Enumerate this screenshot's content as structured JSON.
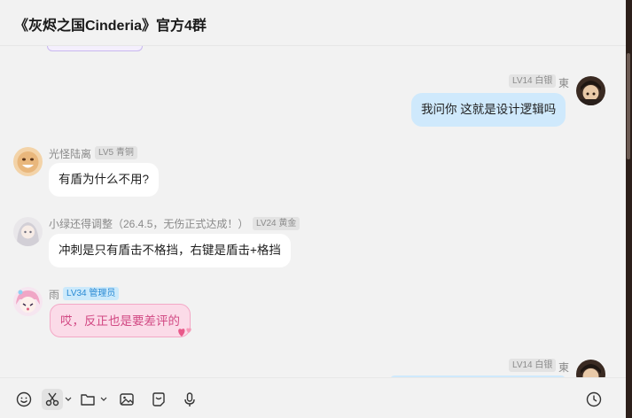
{
  "header": {
    "title": "《灰烬之国Cinderia》官方4群"
  },
  "messages": [
    {
      "side": "right",
      "name": "東",
      "badge": "LV14 白银",
      "text": "我问你 这就是设计逻辑吗"
    },
    {
      "side": "left",
      "name": "光怪陆离",
      "badge": "LV5 青铜",
      "text": "有盾为什么不用?"
    },
    {
      "side": "left",
      "name": "小绿还得调整（26.4.5，无伤正式达成！）",
      "badge": "LV24 黄金",
      "text": "冲刺是只有盾击不格挡，右键是盾击+格挡"
    },
    {
      "side": "left",
      "name": "雨",
      "badge": "LV34 管理员",
      "text": "哎，反正也是要差评的"
    },
    {
      "side": "right",
      "name": "東",
      "badge": "LV14 白银",
      "text": ""
    }
  ],
  "toolbar": {
    "icons": [
      "emoji-icon",
      "scissors-icon",
      "folder-icon",
      "image-icon",
      "sticker-icon",
      "microphone-icon",
      "history-clock-icon"
    ]
  },
  "colors": {
    "background": "#f2f2f2",
    "bubble_self": "#cfe9fc",
    "bubble_other": "#ffffff",
    "bubble_pink": "#fbdbe8",
    "admin_badge": "#cbe9fb"
  }
}
